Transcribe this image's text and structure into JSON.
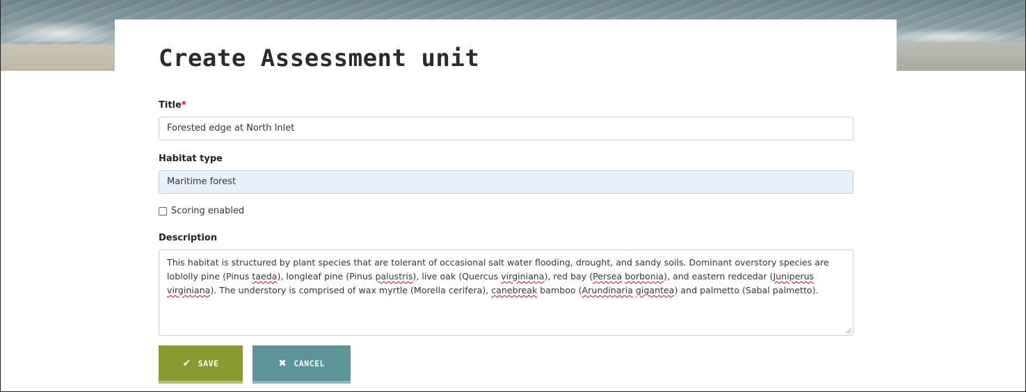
{
  "page": {
    "title": "Create Assessment unit"
  },
  "form": {
    "title_field": {
      "label": "Title",
      "required_mark": "*",
      "value": "Forested edge at North Inlet"
    },
    "habitat_field": {
      "label": "Habitat type",
      "value": "Maritime forest"
    },
    "scoring": {
      "label": "Scoring enabled",
      "checked": false
    },
    "description": {
      "label": "Description",
      "segments": [
        {
          "text": "This habitat is structured by plant species that are tolerant of occasional salt water flooding, drought, and sandy soils. Dominant overstory species are loblolly pine (Pinus "
        },
        {
          "text": "taeda",
          "misspelled": true
        },
        {
          "text": "), longleaf pine (Pinus "
        },
        {
          "text": "palustris",
          "misspelled": true
        },
        {
          "text": "), live oak (Quercus "
        },
        {
          "text": "virginiana",
          "misspelled": true
        },
        {
          "text": "), red bay ("
        },
        {
          "text": "Persea",
          "misspelled": true
        },
        {
          "text": " "
        },
        {
          "text": "borbonia",
          "misspelled": true
        },
        {
          "text": "), and eastern redcedar ("
        },
        {
          "text": "Juniperus",
          "misspelled": true
        },
        {
          "text": " "
        },
        {
          "text": "virginiana",
          "misspelled": true
        },
        {
          "text": "). The understory is comprised of wax myrtle (Morella cerifera), "
        },
        {
          "text": "canebreak",
          "misspelled": true
        },
        {
          "text": " bamboo ("
        },
        {
          "text": "Arundinaria",
          "misspelled": true
        },
        {
          "text": " "
        },
        {
          "text": "gigantea",
          "misspelled": true
        },
        {
          "text": ") and palmetto (Sabal palmetto)."
        }
      ]
    }
  },
  "buttons": {
    "save": {
      "label": "SAVE",
      "icon": "check-icon",
      "color": "#8a9a33"
    },
    "cancel": {
      "label": "CANCEL",
      "icon": "x-icon",
      "color": "#5c9497"
    }
  }
}
